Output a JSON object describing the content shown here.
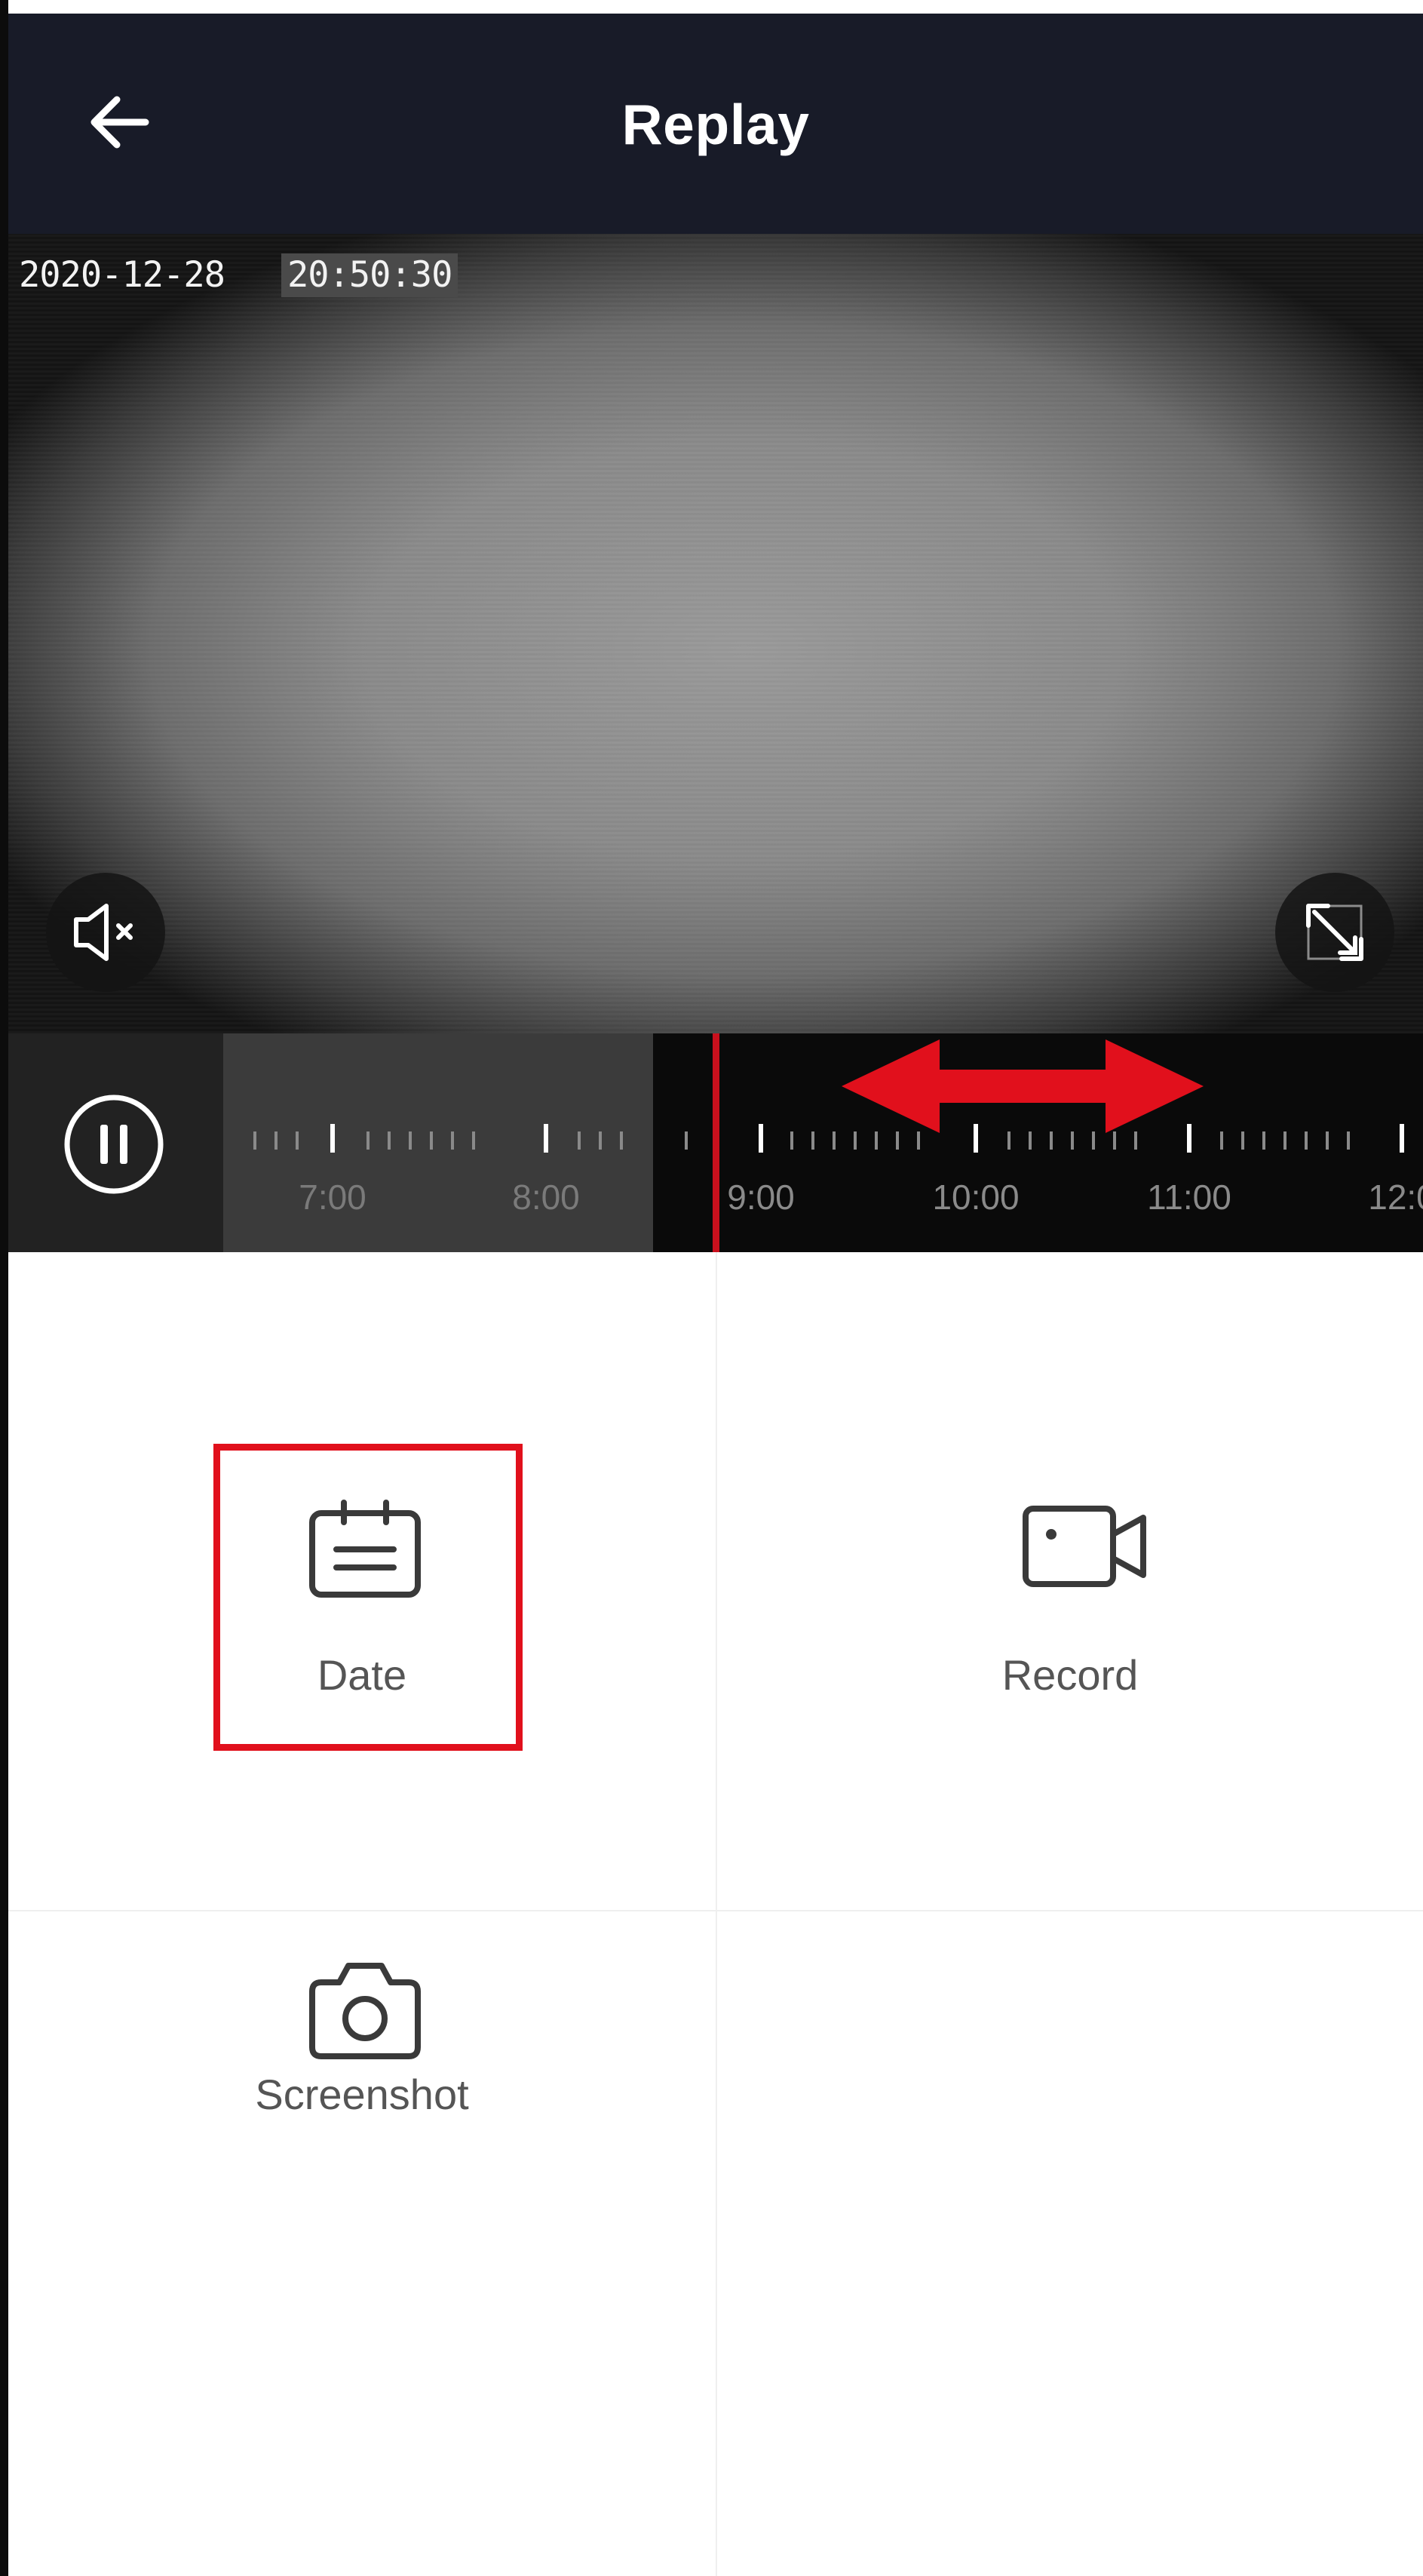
{
  "header": {
    "title": "Replay",
    "back_icon": "arrow-left-icon",
    "background": "#181b28"
  },
  "video": {
    "osd_date": "2020-12-28",
    "osd_time": "20:50:30",
    "mute_icon": "speaker-muted-icon",
    "fullscreen_icon": "expand-icon"
  },
  "timeline": {
    "pause_icon": "pause-icon",
    "labels": [
      "7:00",
      "8:00",
      "9:00",
      "10:00",
      "11:00",
      "12:0"
    ],
    "playhead_color": "#c9101d",
    "drag_hint_icon": "double-arrow-icon",
    "drag_hint_color": "#e1101c"
  },
  "actions": [
    {
      "label": "Date",
      "icon": "calendar-icon",
      "highlighted": true
    },
    {
      "label": "Record",
      "icon": "video-camera-icon",
      "highlighted": false
    },
    {
      "label": "Screenshot",
      "icon": "camera-icon",
      "highlighted": false
    }
  ],
  "colors": {
    "highlight": "#e1101c",
    "label_text": "#555555"
  }
}
